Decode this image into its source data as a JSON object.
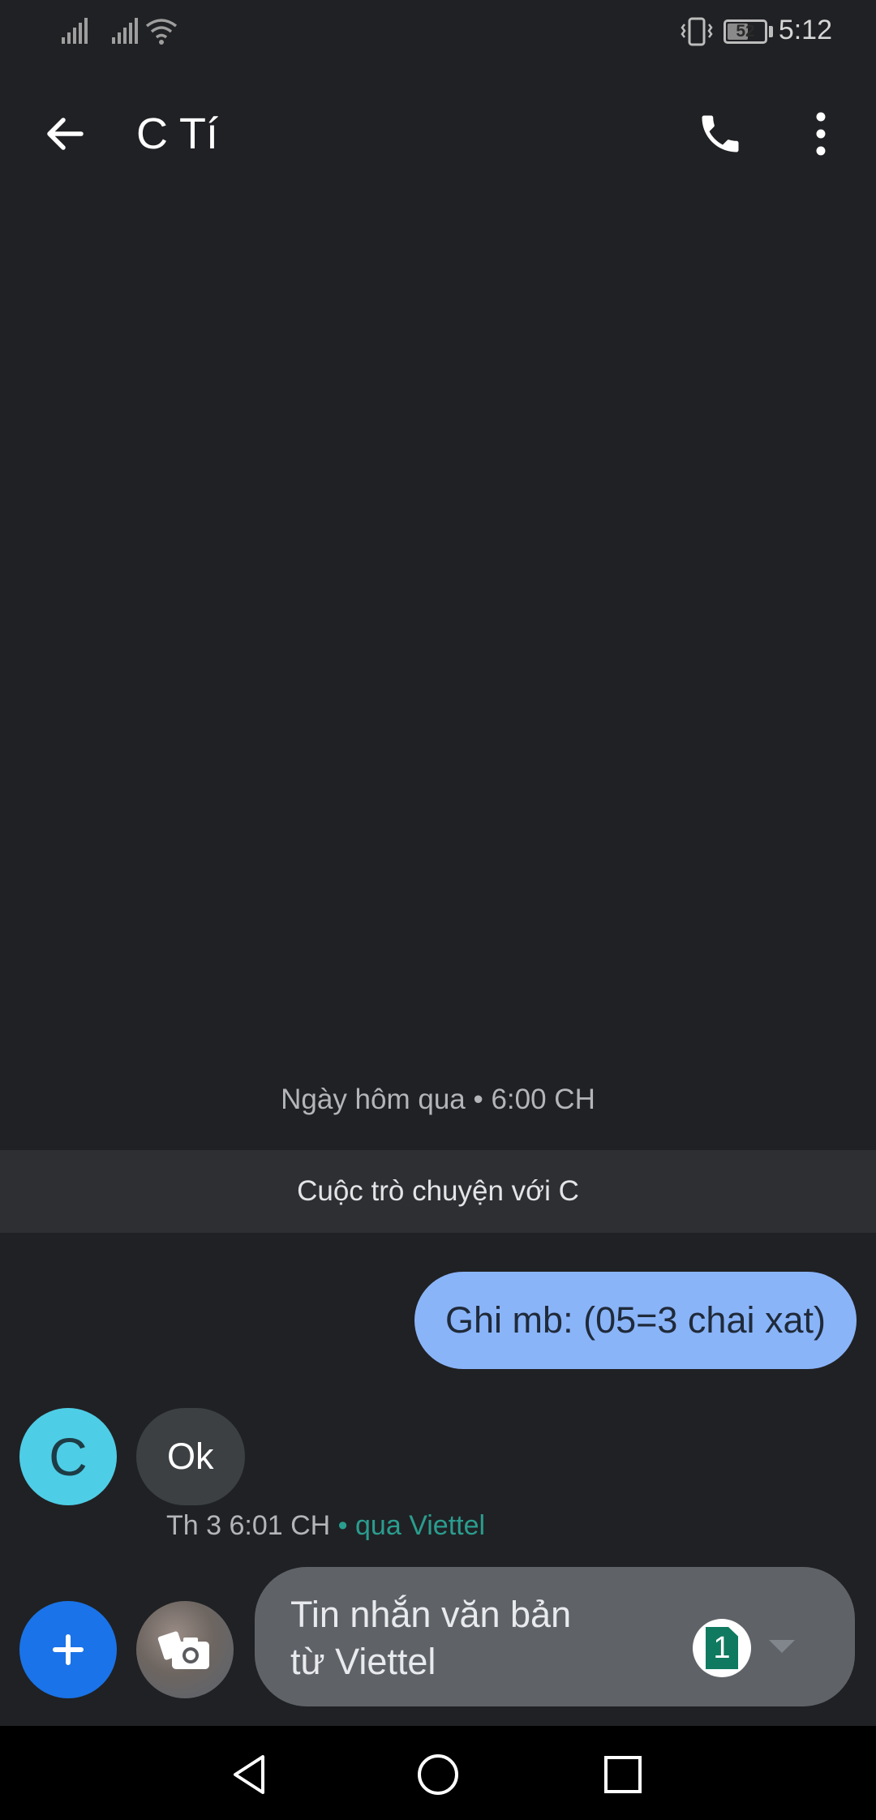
{
  "status_bar": {
    "time": "5:12",
    "battery_level": "52",
    "icons": [
      "signal-icon",
      "signal-icon",
      "wifi-icon",
      "vibrate-icon",
      "battery-icon"
    ]
  },
  "app_bar": {
    "title": "C Tí",
    "icons": [
      "back-arrow-icon",
      "phone-icon",
      "more-vert-icon"
    ]
  },
  "conversation": {
    "timestamp_header": "Ngày hôm qua • 6:00 CH",
    "banner": "Cuộc trò chuyện với C",
    "messages": [
      {
        "direction": "outgoing",
        "text": "Ghi mb: (05=3 chai xat)"
      },
      {
        "direction": "incoming",
        "avatar_letter": "C",
        "text": "Ok",
        "time": "Th 3 6:01 CH",
        "carrier": " • qua Viettel"
      }
    ]
  },
  "compose": {
    "placeholder": "Tin nhắn văn bản từ Viettel",
    "sim_number": "1",
    "icons": [
      "add-icon",
      "gallery-camera-icon",
      "sim-card-icon",
      "dropdown-arrow-icon"
    ]
  },
  "nav_bar": {
    "icons": [
      "nav-back-icon",
      "nav-home-icon",
      "nav-recents-icon"
    ]
  },
  "colors": {
    "background": "#202124",
    "outgoing_bubble": "#8ab4f8",
    "incoming_bubble": "#3c4043",
    "avatar": "#4ecde6",
    "add_button": "#1a73e8",
    "carrier_text": "#2a9d8f",
    "sim_badge": "#0f7a60"
  }
}
